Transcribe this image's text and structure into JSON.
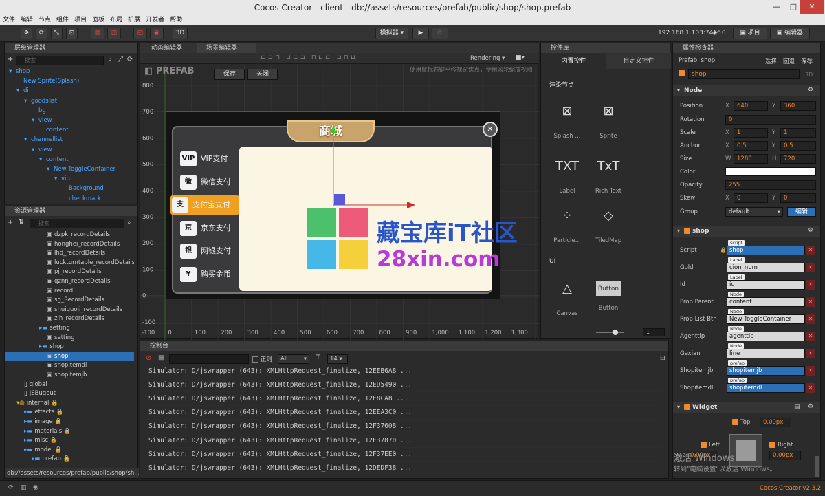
{
  "window": {
    "title": "Cocos Creator - client - db://assets/resources/prefab/public/shop/shop.prefab",
    "min": "—",
    "max": "□",
    "close": "✕"
  },
  "menu": [
    "文件",
    "编辑",
    "节点",
    "组件",
    "项目",
    "面板",
    "布局",
    "扩展",
    "开发者",
    "帮助"
  ],
  "toolbar": {
    "sim_label": "模拟器 ▾",
    "ip": "192.168.1.103:7456",
    "wifi_count": "0",
    "project_btn": "项目",
    "editor_btn": "编辑器",
    "mode_3d": "3D"
  },
  "hierarchy": {
    "title": "层级管理器",
    "search_placeholder": "搜索",
    "rows": [
      {
        "label": "shop",
        "indent": 0,
        "arrow": "▾"
      },
      {
        "label": "New Sprite(Splash)",
        "indent": 1,
        "arrow": ""
      },
      {
        "label": "di",
        "indent": 1,
        "arrow": "▾"
      },
      {
        "label": "goodslist",
        "indent": 2,
        "arrow": "▾"
      },
      {
        "label": "bg",
        "indent": 3,
        "arrow": ""
      },
      {
        "label": "view",
        "indent": 3,
        "arrow": "▾"
      },
      {
        "label": "content",
        "indent": 4,
        "arrow": ""
      },
      {
        "label": "channellist",
        "indent": 2,
        "arrow": "▾"
      },
      {
        "label": "view",
        "indent": 3,
        "arrow": "▾"
      },
      {
        "label": "content",
        "indent": 4,
        "arrow": "▾"
      },
      {
        "label": "New ToggleContainer",
        "indent": 5,
        "arrow": "▾"
      },
      {
        "label": "vip",
        "indent": 6,
        "arrow": "▾"
      },
      {
        "label": "Background",
        "indent": 7,
        "arrow": ""
      },
      {
        "label": "checkmark",
        "indent": 7,
        "arrow": ""
      }
    ]
  },
  "assets": {
    "title": "资源管理器",
    "search_placeholder": "搜索",
    "path": "db://assets/resources/prefab/public/shop/sh...",
    "rows": [
      {
        "label": "dzpk_recordDetails",
        "indent": 5,
        "type": "file"
      },
      {
        "label": "honghei_recordDetails",
        "indent": 5,
        "type": "file"
      },
      {
        "label": "lhd_recordDetails",
        "indent": 5,
        "type": "file"
      },
      {
        "label": "luckturntable_recordDetails",
        "indent": 5,
        "type": "file"
      },
      {
        "label": "pj_recordDetails",
        "indent": 5,
        "type": "file"
      },
      {
        "label": "qznn_recordDetails",
        "indent": 5,
        "type": "file"
      },
      {
        "label": "record",
        "indent": 5,
        "type": "file"
      },
      {
        "label": "sg_RecordDetails",
        "indent": 5,
        "type": "file"
      },
      {
        "label": "shuiguoji_recordDetails",
        "indent": 5,
        "type": "file"
      },
      {
        "label": "zjh_recordDetails",
        "indent": 5,
        "type": "file"
      },
      {
        "label": "setting",
        "indent": 4,
        "type": "folder"
      },
      {
        "label": "setting",
        "indent": 5,
        "type": "file"
      },
      {
        "label": "shop",
        "indent": 4,
        "type": "folder"
      },
      {
        "label": "shop",
        "indent": 5,
        "type": "file",
        "selected": true
      },
      {
        "label": "shopitemdl",
        "indent": 5,
        "type": "file"
      },
      {
        "label": "shopitemjb",
        "indent": 5,
        "type": "file"
      },
      {
        "label": "global",
        "indent": 2,
        "type": "js"
      },
      {
        "label": "JSBugout",
        "indent": 2,
        "type": "js"
      },
      {
        "label": "internal 🔒",
        "indent": 1,
        "type": "db"
      },
      {
        "label": "effects 🔒",
        "indent": 2,
        "type": "folder"
      },
      {
        "label": "image 🔒",
        "indent": 2,
        "type": "folder"
      },
      {
        "label": "materials 🔒",
        "indent": 2,
        "type": "folder"
      },
      {
        "label": "misc 🔒",
        "indent": 2,
        "type": "folder"
      },
      {
        "label": "model 🔒",
        "indent": 2,
        "type": "folder"
      },
      {
        "label": "prefab 🔒",
        "indent": 3,
        "type": "folder"
      }
    ]
  },
  "scene": {
    "tab_anim": "动画编辑器",
    "tab_scene": "场景编辑器",
    "rendering": "Rendering ▾",
    "prefab_label": "PREFAB",
    "save_btn": "保存",
    "close_btn": "关闭",
    "hint": "使用鼠标右键平移视窗焦点，使用滚轮缩放视图",
    "y_ticks": [
      "800",
      "700",
      "600",
      "500",
      "400",
      "300",
      "200",
      "100",
      "0",
      "-100"
    ],
    "x_ticks": [
      "-100",
      "0",
      "100",
      "200",
      "300",
      "400",
      "500",
      "600",
      "700",
      "800",
      "900",
      "1,000",
      "1,100",
      "1,200",
      "1,300"
    ],
    "shop_title": "商城",
    "close_x": "✕",
    "pay_items": [
      {
        "icon": "VIP",
        "label": "VIP支付"
      },
      {
        "icon": "微",
        "label": "微信支付"
      },
      {
        "icon": "支",
        "label": "支付宝支付"
      },
      {
        "icon": "京",
        "label": "京东支付"
      },
      {
        "icon": "银",
        "label": "网银支付"
      },
      {
        "icon": "¥",
        "label": "购买金币"
      }
    ],
    "watermark_cn": "藏宝库iT社区",
    "watermark_url": "28xin.com"
  },
  "console": {
    "title": "控制台",
    "regex": "正则",
    "filter": "All",
    "size": "14",
    "lines": [
      "Simulator: D/jswrapper (643): XMLHttpRequest_finalize, 12EEB6A8 ...",
      "Simulator: D/jswrapper (643): XMLHttpRequest_finalize, 12ED5490 ...",
      "Simulator: D/jswrapper (643): XMLHttpRequest_finalize, 12E8CA8 ...",
      "Simulator: D/jswrapper (643): XMLHttpRequest_finalize, 12EEA3C0 ...",
      "Simulator: D/jswrapper (643): XMLHttpRequest_finalize, 12F37608 ...",
      "Simulator: D/jswrapper (643): XMLHttpRequest_finalize, 12F37870 ...",
      "Simulator: D/jswrapper (643): XMLHttpRequest_finalize, 12F37EE0 ...",
      "Simulator: D/jswrapper (643): XMLHttpRequest_finalize, 12DEDF38 ..."
    ]
  },
  "controls": {
    "title": "控件库",
    "tab_builtin": "内置控件",
    "tab_custom": "自定义控件",
    "sec_render": "渲染节点",
    "sec_ui": "UI",
    "zoom": "1",
    "items": [
      {
        "label": "Splash ...",
        "glyph": "⊠"
      },
      {
        "label": "Sprite",
        "glyph": "⊠"
      },
      {
        "label": "Label",
        "glyph": "TXT"
      },
      {
        "label": "Rich Text",
        "glyph": "TxT"
      },
      {
        "label": "Particle...",
        "glyph": "⁘"
      },
      {
        "label": "TiledMap",
        "glyph": "◇"
      },
      {
        "label": "Canvas",
        "glyph": "△"
      },
      {
        "label": "Button",
        "glyph": "Button"
      }
    ]
  },
  "inspector": {
    "title": "属性检查器",
    "prefab_name": "Prefab:  shop",
    "select": "选择",
    "revert": "回退",
    "save": "保存",
    "node_name": "shop",
    "mode_3d": "3D",
    "node_section": "Node",
    "position_x": "640",
    "position_y": "360",
    "rotation": "0",
    "scale_x": "1",
    "scale_y": "1",
    "anchor_x": "0.5",
    "anchor_y": "0.5",
    "size_w": "1280",
    "size_h": "720",
    "opacity": "255",
    "skew_x": "0",
    "skew_y": "0",
    "group": "default",
    "edit_btn": "编辑",
    "labels": {
      "position": "Position",
      "rotation": "Rotation",
      "scale": "Scale",
      "anchor": "Anchor",
      "size": "Size",
      "color": "Color",
      "opacity": "Opacity",
      "skew": "Skew",
      "group": "Group",
      "x": "X",
      "y": "Y",
      "w": "W",
      "h": "H"
    },
    "shop_section": "shop",
    "props": [
      {
        "label": "Script",
        "tag": "script",
        "value": "shop",
        "style": "blue"
      },
      {
        "label": "Gold",
        "tag": "Label",
        "value": "cion_num",
        "style": "white"
      },
      {
        "label": "Id",
        "tag": "Label",
        "value": "id",
        "style": "white"
      },
      {
        "label": "Prop Parent",
        "tag": "Node",
        "value": "content",
        "style": "white"
      },
      {
        "label": "Prop List Btn",
        "tag": "Node",
        "value": "New ToggleContainer",
        "style": "white"
      },
      {
        "label": "Agenttip",
        "tag": "Node",
        "value": "agenttip",
        "style": "white"
      },
      {
        "label": "Gexian",
        "tag": "Node",
        "value": "line",
        "style": "white"
      },
      {
        "label": "Shopitemjb",
        "tag": "prefab",
        "value": "shopitemjb",
        "style": "blue"
      },
      {
        "label": "Shopitemdl",
        "tag": "prefab",
        "value": "shopitemdl",
        "style": "blue"
      }
    ],
    "widget_section": "Widget",
    "top": "Top",
    "top_val": "0.00px",
    "left": "Left",
    "left_val": "0.00px",
    "right": "Right",
    "right_val": "0.00px"
  },
  "status": {
    "version": "Cocos Creator v2.3.2",
    "activate1": "激活 Windows",
    "activate2": "转到\"电脑设置\"以激活 Windows。"
  }
}
